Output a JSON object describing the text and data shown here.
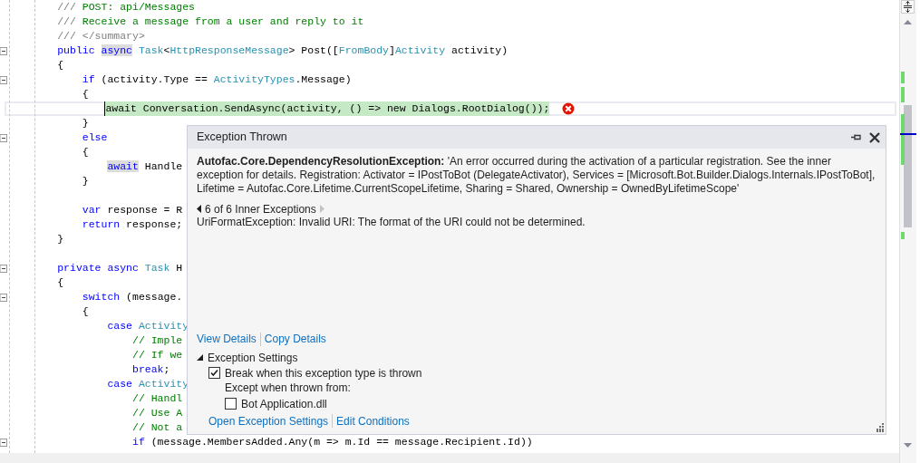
{
  "code": {
    "lines": [
      {
        "kind": "normal",
        "fold": false,
        "tokens": [
          {
            "text": "        /// ",
            "kind": "doc"
          },
          {
            "text": "POST: api/Messages",
            "kind": "comment"
          }
        ]
      },
      {
        "kind": "normal",
        "fold": false,
        "tokens": [
          {
            "text": "        /// ",
            "kind": "doc"
          },
          {
            "text": "Receive a message from a user and reply to it",
            "kind": "comment"
          }
        ]
      },
      {
        "kind": "normal",
        "fold": false,
        "tokens": [
          {
            "text": "        /// </summary>",
            "kind": "doc"
          }
        ]
      },
      {
        "kind": "normal",
        "fold": true,
        "tokens": [
          {
            "text": "        public ",
            "kind": "keyword"
          },
          {
            "text": "async",
            "kind": "keyword_ref"
          },
          {
            "text": " Task",
            "kind": "type"
          },
          {
            "text": "<",
            "kind": "plain"
          },
          {
            "text": "HttpResponseMessage",
            "kind": "type"
          },
          {
            "text": "> Post([",
            "kind": "plain"
          },
          {
            "text": "FromBody",
            "kind": "type"
          },
          {
            "text": "]",
            "kind": "plain"
          },
          {
            "text": "Activity",
            "kind": "type"
          },
          {
            "text": " activity)",
            "kind": "plain"
          }
        ]
      },
      {
        "kind": "normal",
        "fold": false,
        "tokens": [
          {
            "text": "        {",
            "kind": "plain"
          }
        ]
      },
      {
        "kind": "normal",
        "fold": true,
        "tokens": [
          {
            "text": "            if",
            "kind": "keyword"
          },
          {
            "text": " (activity.Type == ",
            "kind": "plain"
          },
          {
            "text": "ActivityTypes",
            "kind": "type"
          },
          {
            "text": ".Message)",
            "kind": "plain"
          }
        ]
      },
      {
        "kind": "normal",
        "fold": false,
        "tokens": [
          {
            "text": "            {",
            "kind": "plain"
          }
        ]
      },
      {
        "kind": "current",
        "fold": false,
        "tokens": [
          {
            "text": "                await Conversation.SendAsync(activity, () => new Dialogs.RootDialog());",
            "kind": "plain"
          }
        ]
      },
      {
        "kind": "normal",
        "fold": false,
        "tokens": [
          {
            "text": "            }",
            "kind": "plain"
          }
        ]
      },
      {
        "kind": "normal",
        "fold": true,
        "tokens": [
          {
            "text": "            else",
            "kind": "keyword"
          }
        ]
      },
      {
        "kind": "normal",
        "fold": false,
        "tokens": [
          {
            "text": "            {",
            "kind": "plain"
          }
        ]
      },
      {
        "kind": "normal",
        "fold": false,
        "tokens": [
          {
            "text": "                await",
            "kind": "keyword_ref"
          },
          {
            "text": " Handle",
            "kind": "plain"
          }
        ]
      },
      {
        "kind": "normal",
        "fold": false,
        "tokens": [
          {
            "text": "            }",
            "kind": "plain"
          }
        ]
      },
      {
        "kind": "blank",
        "fold": false
      },
      {
        "kind": "normal",
        "fold": false,
        "tokens": [
          {
            "text": "            var",
            "kind": "keyword"
          },
          {
            "text": " response = R",
            "kind": "plain"
          }
        ]
      },
      {
        "kind": "normal",
        "fold": false,
        "tokens": [
          {
            "text": "            return",
            "kind": "keyword"
          },
          {
            "text": " response;",
            "kind": "plain"
          }
        ]
      },
      {
        "kind": "normal",
        "fold": false,
        "tokens": [
          {
            "text": "        }",
            "kind": "plain"
          }
        ]
      },
      {
        "kind": "blank",
        "fold": false
      },
      {
        "kind": "normal",
        "fold": true,
        "tokens": [
          {
            "text": "        private async ",
            "kind": "keyword"
          },
          {
            "text": "Task",
            "kind": "type"
          },
          {
            "text": " H",
            "kind": "plain"
          }
        ]
      },
      {
        "kind": "normal",
        "fold": false,
        "tokens": [
          {
            "text": "        {",
            "kind": "plain"
          }
        ]
      },
      {
        "kind": "normal",
        "fold": true,
        "tokens": [
          {
            "text": "            switch",
            "kind": "keyword"
          },
          {
            "text": " (message.",
            "kind": "plain"
          }
        ]
      },
      {
        "kind": "normal",
        "fold": false,
        "tokens": [
          {
            "text": "            {",
            "kind": "plain"
          }
        ]
      },
      {
        "kind": "normal",
        "fold": false,
        "tokens": [
          {
            "text": "                case ",
            "kind": "keyword"
          },
          {
            "text": "Activity",
            "kind": "type"
          }
        ]
      },
      {
        "kind": "normal",
        "fold": false,
        "tokens": [
          {
            "text": "                    // Imple",
            "kind": "comment"
          }
        ]
      },
      {
        "kind": "normal",
        "fold": false,
        "tokens": [
          {
            "text": "                    // If we",
            "kind": "comment"
          }
        ]
      },
      {
        "kind": "normal",
        "fold": false,
        "tokens": [
          {
            "text": "                    break",
            "kind": "keyword"
          },
          {
            "text": ";",
            "kind": "plain"
          }
        ]
      },
      {
        "kind": "normal",
        "fold": false,
        "tokens": [
          {
            "text": "                case ",
            "kind": "keyword"
          },
          {
            "text": "Activity",
            "kind": "type"
          }
        ]
      },
      {
        "kind": "normal",
        "fold": false,
        "tokens": [
          {
            "text": "                    // Handl",
            "kind": "comment"
          }
        ]
      },
      {
        "kind": "normal",
        "fold": false,
        "tokens": [
          {
            "text": "                    // Use A",
            "kind": "comment"
          }
        ]
      },
      {
        "kind": "normal",
        "fold": false,
        "tokens": [
          {
            "text": "                    // Not a",
            "kind": "comment"
          }
        ]
      },
      {
        "kind": "normal",
        "fold": true,
        "tokens": [
          {
            "text": "                    if",
            "kind": "keyword"
          },
          {
            "text": " (message.MembersAdded.Any(m => m.Id == message.Recipient.Id))",
            "kind": "plain"
          }
        ]
      }
    ]
  },
  "exception_popup": {
    "title": "Exception Thrown",
    "message": "**Autofac.Core.DependencyResolutionException:** 'An error occurred during the activation of a particular registration. See the inner exception for details. Registration: Activator = IPostToBot (DelegateActivator), Services = [Microsoft.Bot.Builder.Dialogs.Internals.IPostToBot], Lifetime = Autofac.Core.Lifetime.CurrentScopeLifetime, Sharing = Shared, Ownership = OwnedByLifetimeScope'",
    "inner_nav": {
      "label": "6 of 6 Inner Exceptions",
      "prev_enabled": true,
      "next_enabled": false
    },
    "inner_message": "UriFormatException: Invalid URI: The format of the URI could not be determined.",
    "links": [
      "View Details",
      "Copy Details"
    ],
    "settings": {
      "title": "Exception Settings",
      "expanded": true,
      "break_option": {
        "label": "Break when this exception type is thrown",
        "checked": true
      },
      "except_label": "Except when thrown from:",
      "modules": [
        {
          "label": "Bot Application.dll",
          "checked": false
        }
      ],
      "links": [
        "Open Exception Settings",
        "Edit Conditions"
      ]
    }
  }
}
